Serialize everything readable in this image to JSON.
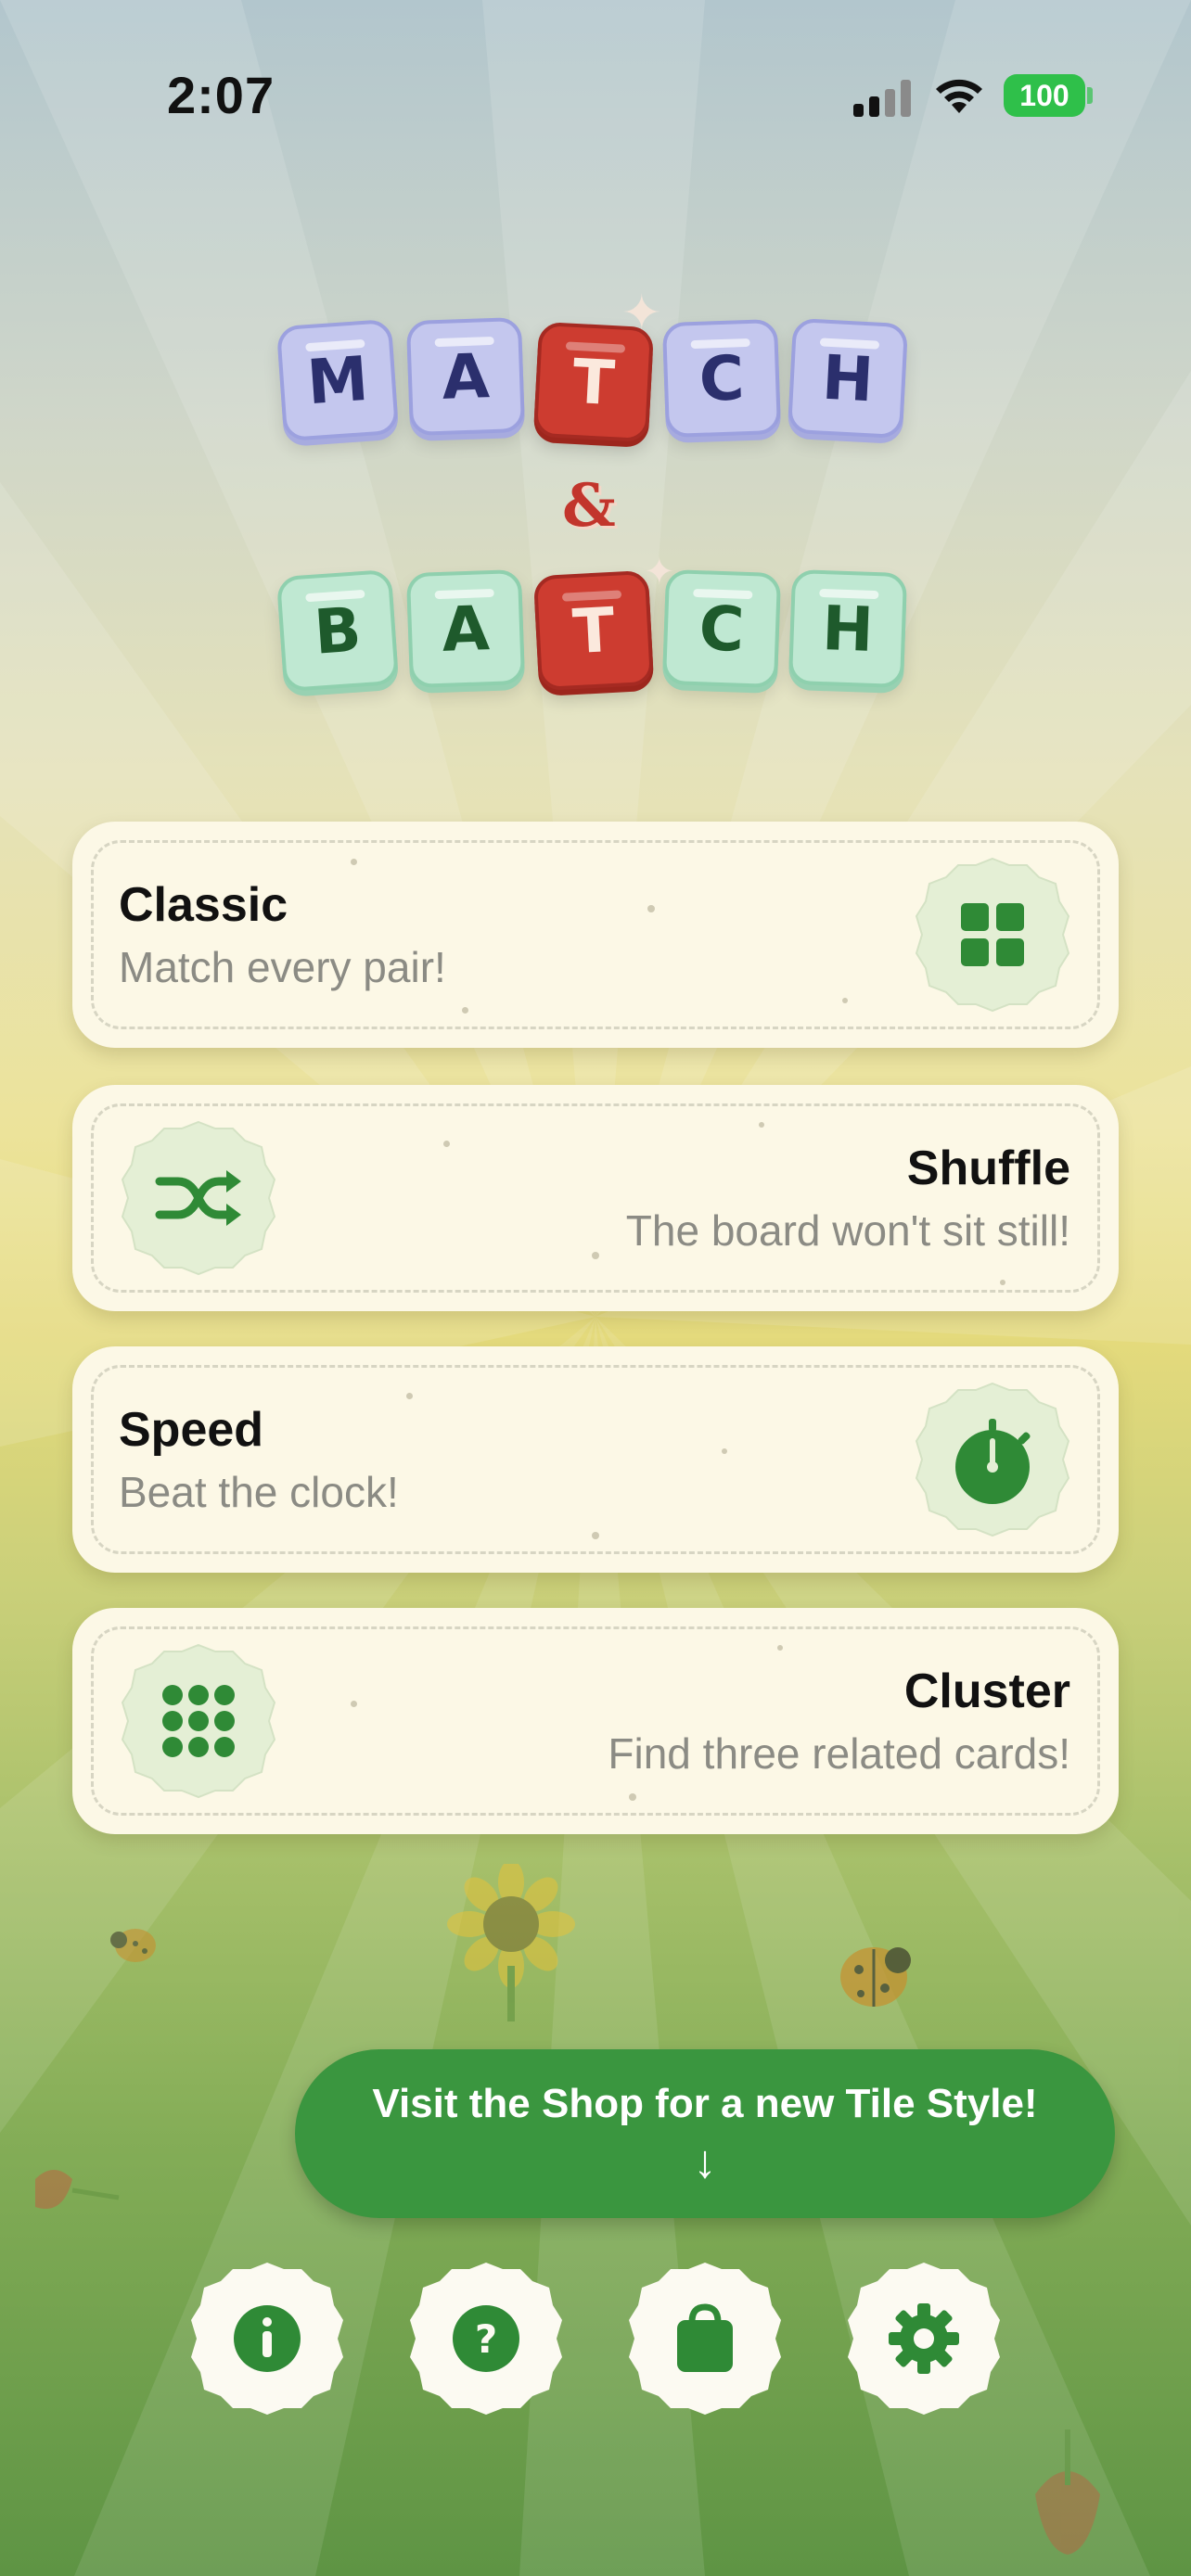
{
  "status_bar": {
    "time": "2:07",
    "battery": "100"
  },
  "logo": {
    "top_word": [
      "M",
      "A",
      "T",
      "C",
      "H"
    ],
    "ampersand": "&",
    "bottom_word": [
      "B",
      "A",
      "T",
      "C",
      "H"
    ],
    "colors": {
      "top_tile": "#c4c7ee",
      "bottom_tile": "#bfe8d2",
      "highlight_tile": "#cd3c30"
    }
  },
  "modes": [
    {
      "title": "Classic",
      "subtitle": "Match every pair!",
      "icon": "grid-icon"
    },
    {
      "title": "Shuffle",
      "subtitle": "The board won't sit still!",
      "icon": "shuffle-icon"
    },
    {
      "title": "Speed",
      "subtitle": "Beat the clock!",
      "icon": "stopwatch-icon"
    },
    {
      "title": "Cluster",
      "subtitle": "Find three related cards!",
      "icon": "dots-grid-icon"
    }
  ],
  "shop_banner": {
    "label": "Visit the Shop for a new Tile Style!",
    "arrow": "↓"
  },
  "bottom_buttons": [
    {
      "name": "info",
      "icon": "info-icon"
    },
    {
      "name": "help",
      "icon": "question-icon"
    },
    {
      "name": "shop",
      "icon": "shopping-bag-icon"
    },
    {
      "name": "settings",
      "icon": "gear-icon"
    }
  ],
  "colors": {
    "accent_green": "#3a963f",
    "card_bg": "#fcf8e6",
    "icon_green": "#2f8a36"
  }
}
